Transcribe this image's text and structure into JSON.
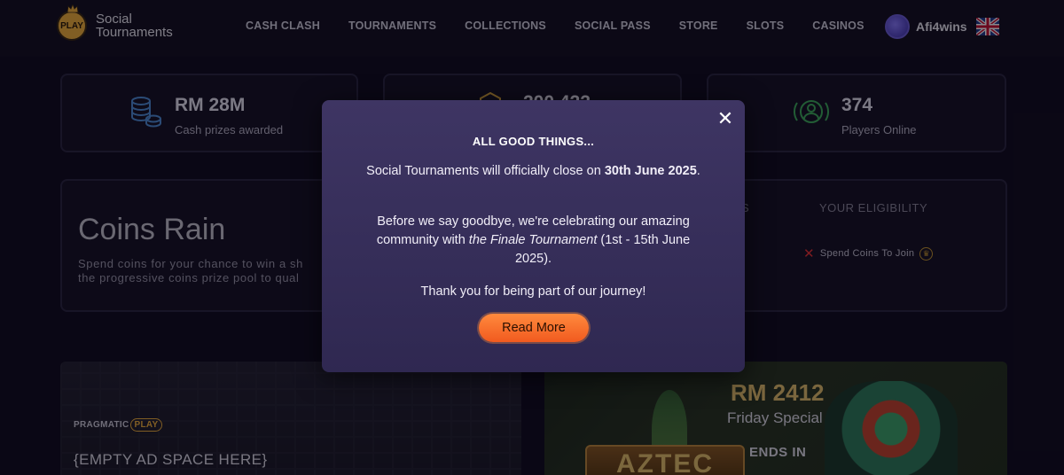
{
  "header": {
    "logo_badge": "PLAY",
    "logo_line1": "Social",
    "logo_line2": "Tournaments",
    "nav": [
      "CASH CLASH",
      "TOURNAMENTS",
      "COLLECTIONS",
      "SOCIAL PASS",
      "STORE",
      "SLOTS",
      "CASINOS"
    ],
    "username": "Afi4wins",
    "flag_icon": "uk-flag-icon"
  },
  "stats": [
    {
      "value": "RM 28M",
      "label": "Cash prizes awarded",
      "icon": "coins-stack-icon",
      "color": "#4f8fd6"
    },
    {
      "value": "200,422",
      "label": "",
      "icon": "hex-badge-icon",
      "color": "#d8a63a"
    },
    {
      "value": "374",
      "label": "Players Online",
      "icon": "players-online-icon",
      "color": "#3fae5a"
    }
  ],
  "coins_rain": {
    "title": "Coins Rain",
    "desc_line1": "Spend coins for your chance to win a sh",
    "desc_line2": "the progressive coins prize pool to qual",
    "col_partial": "S",
    "eligibility_header": "YOUR ELIGIBILITY",
    "eligibility_status": "Spend Coins To Join"
  },
  "ad": {
    "brand": "PRAGMATIC",
    "brand_ring": "PLAY",
    "text": "{EMPTY AD SPACE HERE}"
  },
  "promo": {
    "game_logo": "AZTEC",
    "amount": "RM 2412",
    "name": "Friday Special",
    "ends_label": "ENDS IN"
  },
  "modal": {
    "title": "ALL GOOD THINGS...",
    "p1_text": "Social Tournaments will officially close on",
    "p1_bold": "30th June 2025",
    "p2_text": "Before we say goodbye, we're celebrating our amazing community with",
    "p2_italic": "the Finale Tournament",
    "p2_tail": "(1st - 15th June 2025).",
    "p3": "Thank you for being part of our journey!",
    "button": "Read More",
    "close_symbol": "✕"
  },
  "colors": {
    "accent_orange": "#f15a1f",
    "modal_bg": "#3e3563",
    "gold": "#e7c26b"
  }
}
